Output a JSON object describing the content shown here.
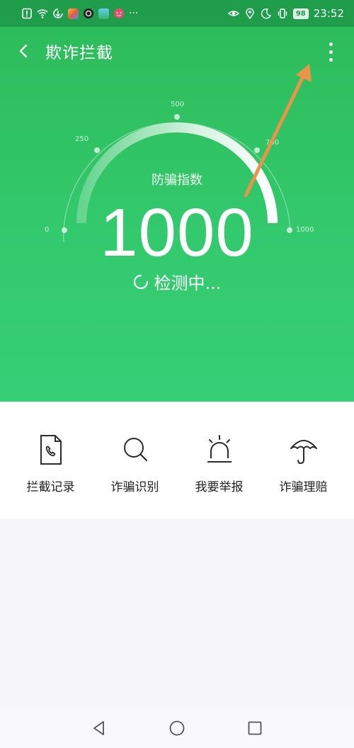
{
  "status_bar": {
    "time": "23:52",
    "battery": "98",
    "more_indicator": "···",
    "left_icons": [
      "alert-icon",
      "wifi-icon",
      "data-saver-icon",
      "app-notification-icon",
      "camera-app-icon",
      "gallery-app-icon",
      "message-app-icon"
    ],
    "right_icons": [
      "eye-comfort-icon",
      "location-icon",
      "do-not-disturb-icon",
      "vibrate-icon"
    ]
  },
  "header": {
    "title": "欺诈拦截",
    "back_icon": "back-arrow-icon",
    "more_icon": "more-vertical-icon"
  },
  "gauge": {
    "label": "防骗指数",
    "score": "1000",
    "status": "检测中...",
    "scale": {
      "min": 0,
      "max": 1000
    },
    "ticks": [
      "0",
      "250",
      "500",
      "750",
      "1000"
    ],
    "progress": 1.0
  },
  "actions": [
    {
      "label": "拦截记录",
      "icon": "call-record-icon"
    },
    {
      "label": "诈骗识别",
      "icon": "search-icon"
    },
    {
      "label": "我要举报",
      "icon": "alarm-siren-icon"
    },
    {
      "label": "诈骗理赔",
      "icon": "umbrella-icon"
    }
  ],
  "nav_bar": {
    "icons": [
      "back-triangle-icon",
      "home-circle-icon",
      "recents-square-icon"
    ]
  },
  "colors": {
    "primary_green": "#2dbc5b",
    "status_green": "#1f9d4b",
    "arrow_annotation": "#e8944a"
  }
}
